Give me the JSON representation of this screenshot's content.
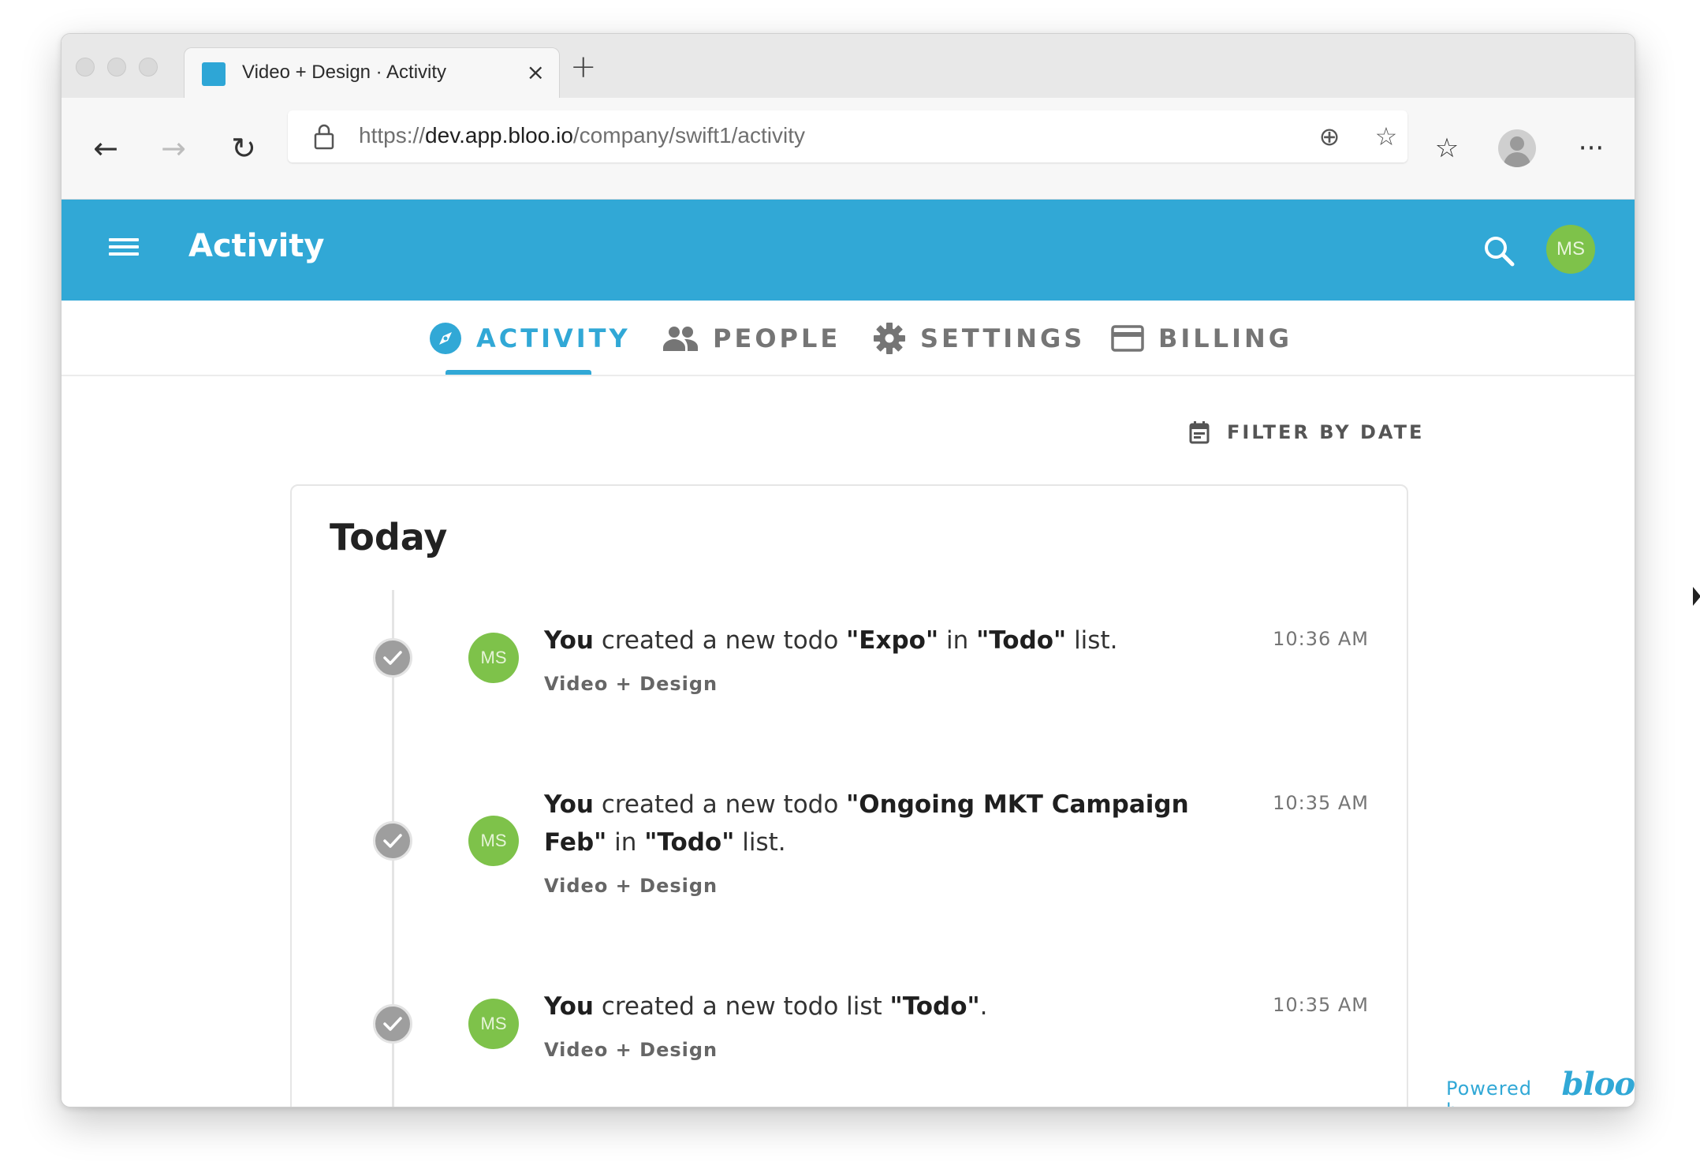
{
  "browser": {
    "tab_title": "Video + Design · Activity",
    "tab_close": "×",
    "new_tab": "+",
    "url_scheme": "https://",
    "url_host": "dev.app.bloo.io",
    "url_path": "/company/swift1/activity",
    "icons": {
      "back": "←",
      "forward": "→",
      "reload": "↻",
      "add_site": "⊕",
      "star": "☆",
      "favorites": "☆",
      "more": "···"
    }
  },
  "app": {
    "title": "Activity",
    "user_initials": "MS",
    "accent_color": "#31a8d6",
    "avatar_color": "#7ec24a"
  },
  "nav": {
    "tabs": [
      {
        "label": "ACTIVITY",
        "icon": "compass-icon",
        "active": true
      },
      {
        "label": "PEOPLE",
        "icon": "people-icon",
        "active": false
      },
      {
        "label": "SETTINGS",
        "icon": "gear-icon",
        "active": false
      },
      {
        "label": "BILLING",
        "icon": "credit-card-icon",
        "active": false
      }
    ]
  },
  "filter": {
    "label": "FILTER BY DATE"
  },
  "feed": {
    "section_title": "Today",
    "entries": [
      {
        "actor": "You",
        "text_before": " created a new todo ",
        "target": "\"Expo\"",
        "text_middle": " in ",
        "container": "\"Todo\"",
        "text_after": " list.",
        "project": "Video + Design",
        "time": "10:36 AM",
        "initials": "MS"
      },
      {
        "actor": "You",
        "text_before": " created a new todo ",
        "target": "\"Ongoing MKT Campaign Feb\"",
        "text_middle": " in ",
        "container": "\"Todo\"",
        "text_after": " list.",
        "project": "Video + Design",
        "time": "10:35 AM",
        "initials": "MS"
      },
      {
        "actor": "You",
        "text_before": " created a new todo list ",
        "target": "\"Todo\"",
        "text_middle": "",
        "container": "",
        "text_after": ".",
        "project": "Video + Design",
        "time": "10:35 AM",
        "initials": "MS"
      }
    ]
  },
  "footer": {
    "powered_label": "Powered by",
    "brand": "bloo"
  }
}
